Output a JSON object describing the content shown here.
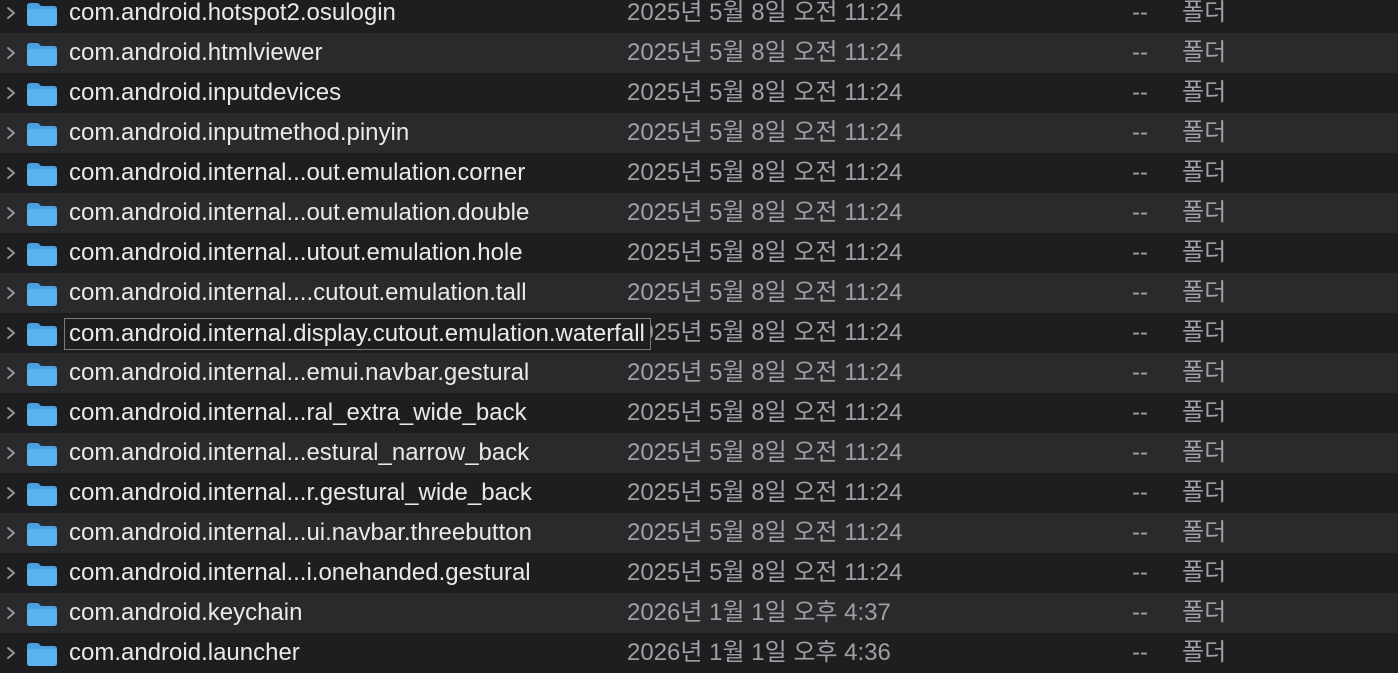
{
  "icons": {
    "disclosure": "chevron-right-icon",
    "folder": "folder-icon"
  },
  "colors": {
    "folder": "#5bb3ee",
    "folder_tab": "#4aa1e0",
    "text_primary": "#e9e9ea",
    "text_secondary": "#a0a0a4"
  },
  "rows": [
    {
      "name": "com.android.hotspot2.osulogin",
      "date": "2025년 5월 8일 오전 11:24",
      "size": "--",
      "kind": "폴더"
    },
    {
      "name": "com.android.htmlviewer",
      "date": "2025년 5월 8일 오전 11:24",
      "size": "--",
      "kind": "폴더"
    },
    {
      "name": "com.android.inputdevices",
      "date": "2025년 5월 8일 오전 11:24",
      "size": "--",
      "kind": "폴더"
    },
    {
      "name": "com.android.inputmethod.pinyin",
      "date": "2025년 5월 8일 오전 11:24",
      "size": "--",
      "kind": "폴더"
    },
    {
      "name": "com.android.internal...out.emulation.corner",
      "date": "2025년 5월 8일 오전 11:24",
      "size": "--",
      "kind": "폴더"
    },
    {
      "name": "com.android.internal...out.emulation.double",
      "date": "2025년 5월 8일 오전 11:24",
      "size": "--",
      "kind": "폴더"
    },
    {
      "name": "com.android.internal...utout.emulation.hole",
      "date": "2025년 5월 8일 오전 11:24",
      "size": "--",
      "kind": "폴더"
    },
    {
      "name": "com.android.internal....cutout.emulation.tall",
      "date": "2025년 5월 8일 오전 11:24",
      "size": "--",
      "kind": "폴더"
    },
    {
      "name": "com.android.internal.display.cutout.emulation.waterfall",
      "date": "2025년 5월 8일 오전 11:24",
      "size": "--",
      "kind": "폴더"
    },
    {
      "name": "com.android.internal...emui.navbar.gestural",
      "date": "2025년 5월 8일 오전 11:24",
      "size": "--",
      "kind": "폴더"
    },
    {
      "name": "com.android.internal...ral_extra_wide_back",
      "date": "2025년 5월 8일 오전 11:24",
      "size": "--",
      "kind": "폴더"
    },
    {
      "name": "com.android.internal...estural_narrow_back",
      "date": "2025년 5월 8일 오전 11:24",
      "size": "--",
      "kind": "폴더"
    },
    {
      "name": "com.android.internal...r.gestural_wide_back",
      "date": "2025년 5월 8일 오전 11:24",
      "size": "--",
      "kind": "폴더"
    },
    {
      "name": "com.android.internal...ui.navbar.threebutton",
      "date": "2025년 5월 8일 오전 11:24",
      "size": "--",
      "kind": "폴더"
    },
    {
      "name": "com.android.internal...i.onehanded.gestural",
      "date": "2025년 5월 8일 오전 11:24",
      "size": "--",
      "kind": "폴더"
    },
    {
      "name": "com.android.keychain",
      "date": "2026년 1월 1일 오후 4:37",
      "size": "--",
      "kind": "폴더"
    },
    {
      "name": "com.android.launcher",
      "date": "2026년 1월 1일 오후 4:36",
      "size": "--",
      "kind": "폴더"
    }
  ]
}
